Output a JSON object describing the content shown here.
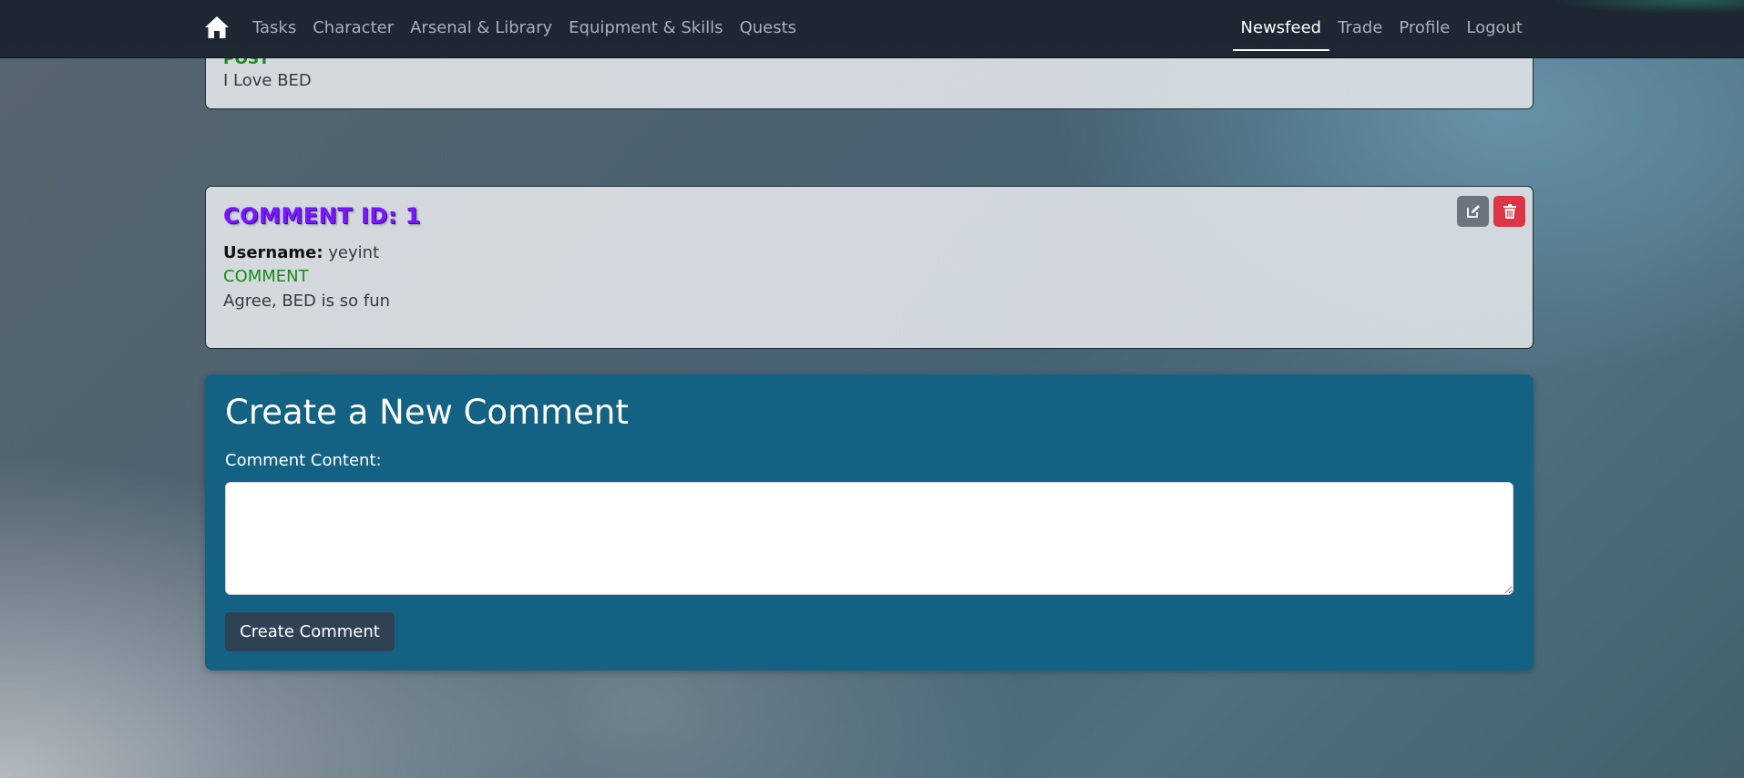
{
  "navbar": {
    "home_icon": "home-icon",
    "left_links": [
      "Tasks",
      "Character",
      "Arsenal & Library",
      "Equipment & Skills",
      "Quests"
    ],
    "right_links": [
      "Newsfeed",
      "Trade",
      "Profile",
      "Logout"
    ],
    "active_link": "Newsfeed"
  },
  "post": {
    "label": "POST",
    "content": "I Love BED"
  },
  "comment": {
    "title": "COMMENT ID: 1",
    "username_label": "Username:",
    "username": "yeyint",
    "type_label": "COMMENT",
    "content": "Agree, BED is so fun",
    "edit_icon": "edit-icon",
    "delete_icon": "trash-icon",
    "edit_color": "#6c757d",
    "delete_color": "#dc3545"
  },
  "form": {
    "title": "Create a New Comment",
    "label": "Comment Content:",
    "textarea_value": "",
    "submit_label": "Create Comment",
    "panel_color": "#136283"
  }
}
